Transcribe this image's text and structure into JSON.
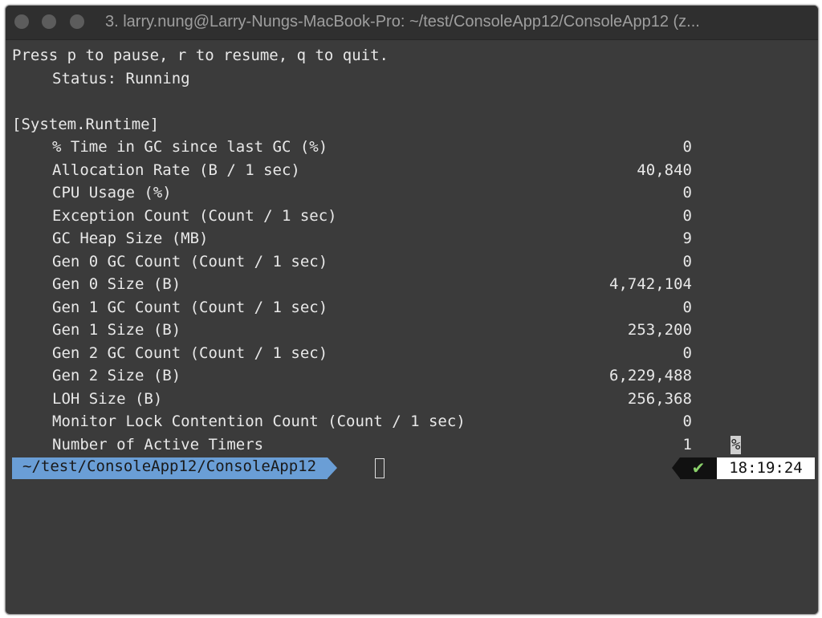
{
  "window": {
    "title": "3. larry.nung@Larry-Nungs-MacBook-Pro: ~/test/ConsoleApp12/ConsoleApp12 (z..."
  },
  "terminal": {
    "header_line": "Press p to pause, r to resume, q to quit.",
    "status_line": "Status: Running",
    "section": "[System.Runtime]",
    "counters": [
      {
        "name": "% Time in GC since last GC (%)",
        "value": "0"
      },
      {
        "name": "Allocation Rate (B / 1 sec)",
        "value": "40,840"
      },
      {
        "name": "CPU Usage (%)",
        "value": "0"
      },
      {
        "name": "Exception Count (Count / 1 sec)",
        "value": "0"
      },
      {
        "name": "GC Heap Size (MB)",
        "value": "9"
      },
      {
        "name": "Gen 0 GC Count (Count / 1 sec)",
        "value": "0"
      },
      {
        "name": "Gen 0 Size (B)",
        "value": "4,742,104"
      },
      {
        "name": "Gen 1 GC Count (Count / 1 sec)",
        "value": "0"
      },
      {
        "name": "Gen 1 Size (B)",
        "value": "253,200"
      },
      {
        "name": "Gen 2 GC Count (Count / 1 sec)",
        "value": "0"
      },
      {
        "name": "Gen 2 Size (B)",
        "value": "6,229,488"
      },
      {
        "name": "LOH Size (B)",
        "value": "256,368"
      },
      {
        "name": "Monitor Lock Contention Count (Count / 1 sec)",
        "value": "0"
      },
      {
        "name": "Number of Active Timers",
        "value": "1"
      }
    ],
    "percent_marker": "%"
  },
  "prompt": {
    "path": "~/test/ConsoleApp12/ConsoleApp12",
    "status_icon": "✔",
    "time": "18:19:24"
  },
  "colors": {
    "background": "#3b3b3b",
    "path_segment": "#6a9ed6",
    "check": "#8ad16a"
  }
}
